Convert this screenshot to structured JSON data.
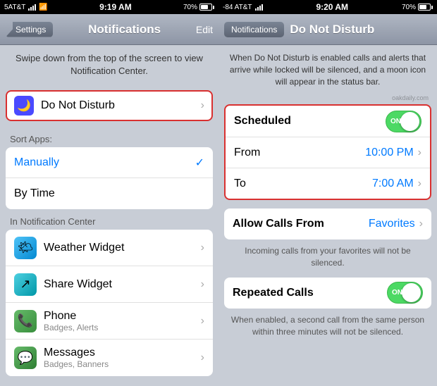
{
  "left": {
    "status_bar": {
      "carrier": "5AT&T",
      "time": "9:19 AM",
      "signal": "70%"
    },
    "nav": {
      "back_label": "Settings",
      "title": "Notifications",
      "edit_label": "Edit"
    },
    "description": "Swipe down from the top of the screen to view Notification Center.",
    "do_not_disturb": {
      "label": "Do Not Disturb"
    },
    "sort_apps_header": "Sort Apps:",
    "sort_items": [
      {
        "label": "Manually",
        "checked": true
      },
      {
        "label": "By Time",
        "checked": false
      }
    ],
    "in_notification_center_header": "In Notification Center",
    "apps": [
      {
        "name": "Weather Widget",
        "sub": "",
        "icon": "weather"
      },
      {
        "name": "Share Widget",
        "sub": "",
        "icon": "share"
      },
      {
        "name": "Phone",
        "sub": "Badges, Alerts",
        "icon": "phone"
      },
      {
        "name": "Messages",
        "sub": "Badges, Banners",
        "icon": "messages"
      }
    ],
    "chevron": "›"
  },
  "right": {
    "status_bar": {
      "carrier": "-84 AT&T",
      "time": "9:20 AM",
      "signal": "70%"
    },
    "nav": {
      "back_label": "Notifications",
      "title": "Do Not Disturb"
    },
    "description": "When Do Not Disturb is enabled calls and alerts that arrive while locked will be silenced, and a moon icon will appear in the status bar.",
    "scheduled": {
      "label": "Scheduled",
      "toggle_text": "ON",
      "is_on": true
    },
    "from_row": {
      "label": "From",
      "value": "10:00 PM"
    },
    "to_row": {
      "label": "To",
      "value": "7:00 AM"
    },
    "allow_calls": {
      "label": "Allow Calls From",
      "value": "Favorites",
      "sub_text": "Incoming calls from your favorites will not be silenced."
    },
    "repeated_calls": {
      "label": "Repeated Calls",
      "toggle_text": "ON",
      "is_on": true,
      "sub_text": "When enabled, a second call from the same person within three minutes will not be silenced."
    },
    "chevron": "›",
    "watermark": "oakdaily.com"
  }
}
